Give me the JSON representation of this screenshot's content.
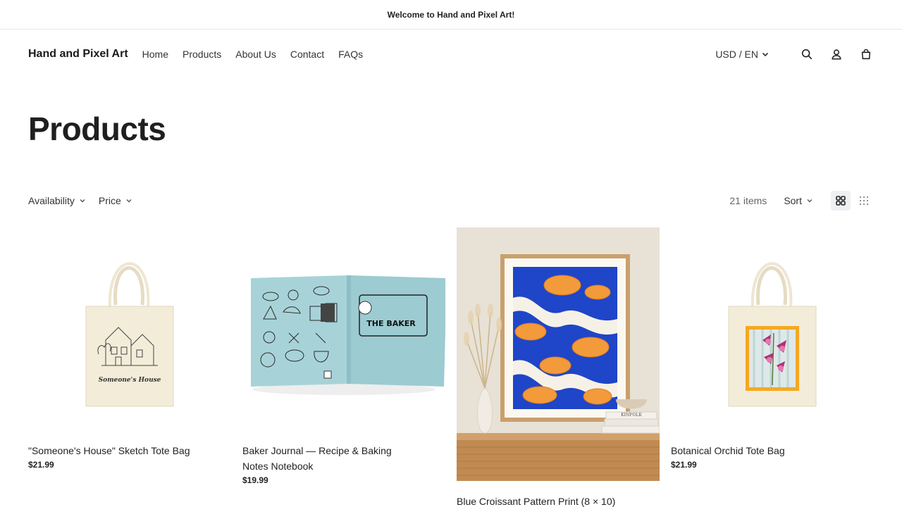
{
  "announcement": {
    "text": "Welcome to Hand and Pixel Art!"
  },
  "header": {
    "logo": "Hand and Pixel Art",
    "nav": [
      "Home",
      "Products",
      "About Us",
      "Contact",
      "FAQs"
    ],
    "locale": "USD / EN",
    "icons": [
      "search-icon",
      "account-icon",
      "cart-icon"
    ]
  },
  "page": {
    "title": "Products"
  },
  "filters": {
    "availability": "Availability",
    "price": "Price",
    "count": "21 items",
    "sort": "Sort"
  },
  "products": [
    {
      "title": "\"Someone's House\" Sketch Tote Bag",
      "price": "$21.99",
      "image_caption": "Someone's House"
    },
    {
      "title": "Baker Journal — Recipe & Baking Notes Notebook",
      "price": "$19.99",
      "image_caption": "THE BAKER"
    },
    {
      "title": "Blue Croissant Pattern Print (8 × 10)",
      "price": "",
      "image_caption": "KINFOLK"
    },
    {
      "title": "Botanical Orchid Tote Bag",
      "price": "$21.99",
      "image_caption": ""
    }
  ],
  "colors": {
    "journal": "#9fd0d6",
    "print_blue": "#1f45c8",
    "croissant": "#f39a3b",
    "tote": "#f3ecd9"
  }
}
